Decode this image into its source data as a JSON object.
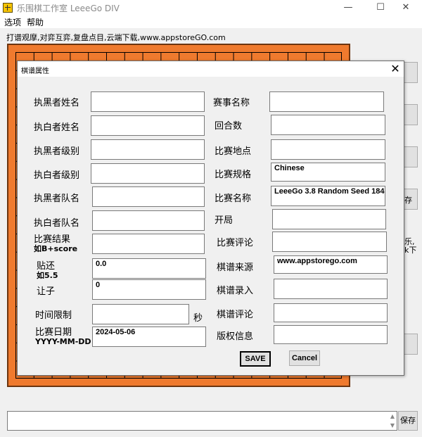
{
  "window": {
    "title": "乐围棋工作室 LeeeGo DIV",
    "minimize_glyph": "—",
    "maximize_glyph": "☐",
    "close_glyph": "✕"
  },
  "menu": [
    "选项",
    "帮助"
  ],
  "info_line": "打谱观摩,对弈互弈,复盘点目,云端下载,www.appstoreGO.com",
  "side_fragments": [
    "存",
    "乐,",
    "k下"
  ],
  "bottom": {
    "comment_value": "",
    "save_label": "保存",
    "scroll_up": "▲",
    "scroll_down": "▼"
  },
  "dialog": {
    "title": "棋谱属性",
    "close_glyph": "✕",
    "left_fields": [
      {
        "label": "执黑者姓名",
        "value": ""
      },
      {
        "label": "执白者姓名",
        "value": ""
      },
      {
        "label": "执黑者级别",
        "value": ""
      },
      {
        "label": "执白者级别",
        "value": ""
      },
      {
        "label": "执黑者队名",
        "value": ""
      },
      {
        "label": "执白者队名",
        "value": ""
      },
      {
        "label": "比赛结果",
        "sub": "如B+score",
        "value": ""
      },
      {
        "label": "贴还",
        "sub": "如5.5",
        "value": "0.0"
      },
      {
        "label": "让子",
        "value": "0"
      },
      {
        "label": "时间限制",
        "value": "",
        "unit": "秒"
      },
      {
        "label": "比赛日期",
        "sub": "YYYY-MM-DD",
        "value": "2024-05-06"
      }
    ],
    "right_fields": [
      {
        "label": "赛事名称",
        "value": ""
      },
      {
        "label": "回合数",
        "value": ""
      },
      {
        "label": "比赛地点",
        "value": ""
      },
      {
        "label": "比赛规格",
        "value": "Chinese"
      },
      {
        "label": "比赛名称",
        "value": "LeeeGo 3.8 Random Seed 184"
      },
      {
        "label": "开局",
        "value": ""
      },
      {
        "label": "比赛评论",
        "value": ""
      },
      {
        "label": "棋谱来源",
        "value": "www.appstorego.com"
      },
      {
        "label": "棋谱录入",
        "value": ""
      },
      {
        "label": "棋谱评论",
        "value": ""
      },
      {
        "label": "版权信息",
        "value": ""
      }
    ],
    "save_label": "SAVE",
    "cancel_label": "Cancel"
  },
  "colors": {
    "board": "#ef7a2e",
    "board_border": "#6b3510",
    "app_icon": "#f6c400"
  }
}
